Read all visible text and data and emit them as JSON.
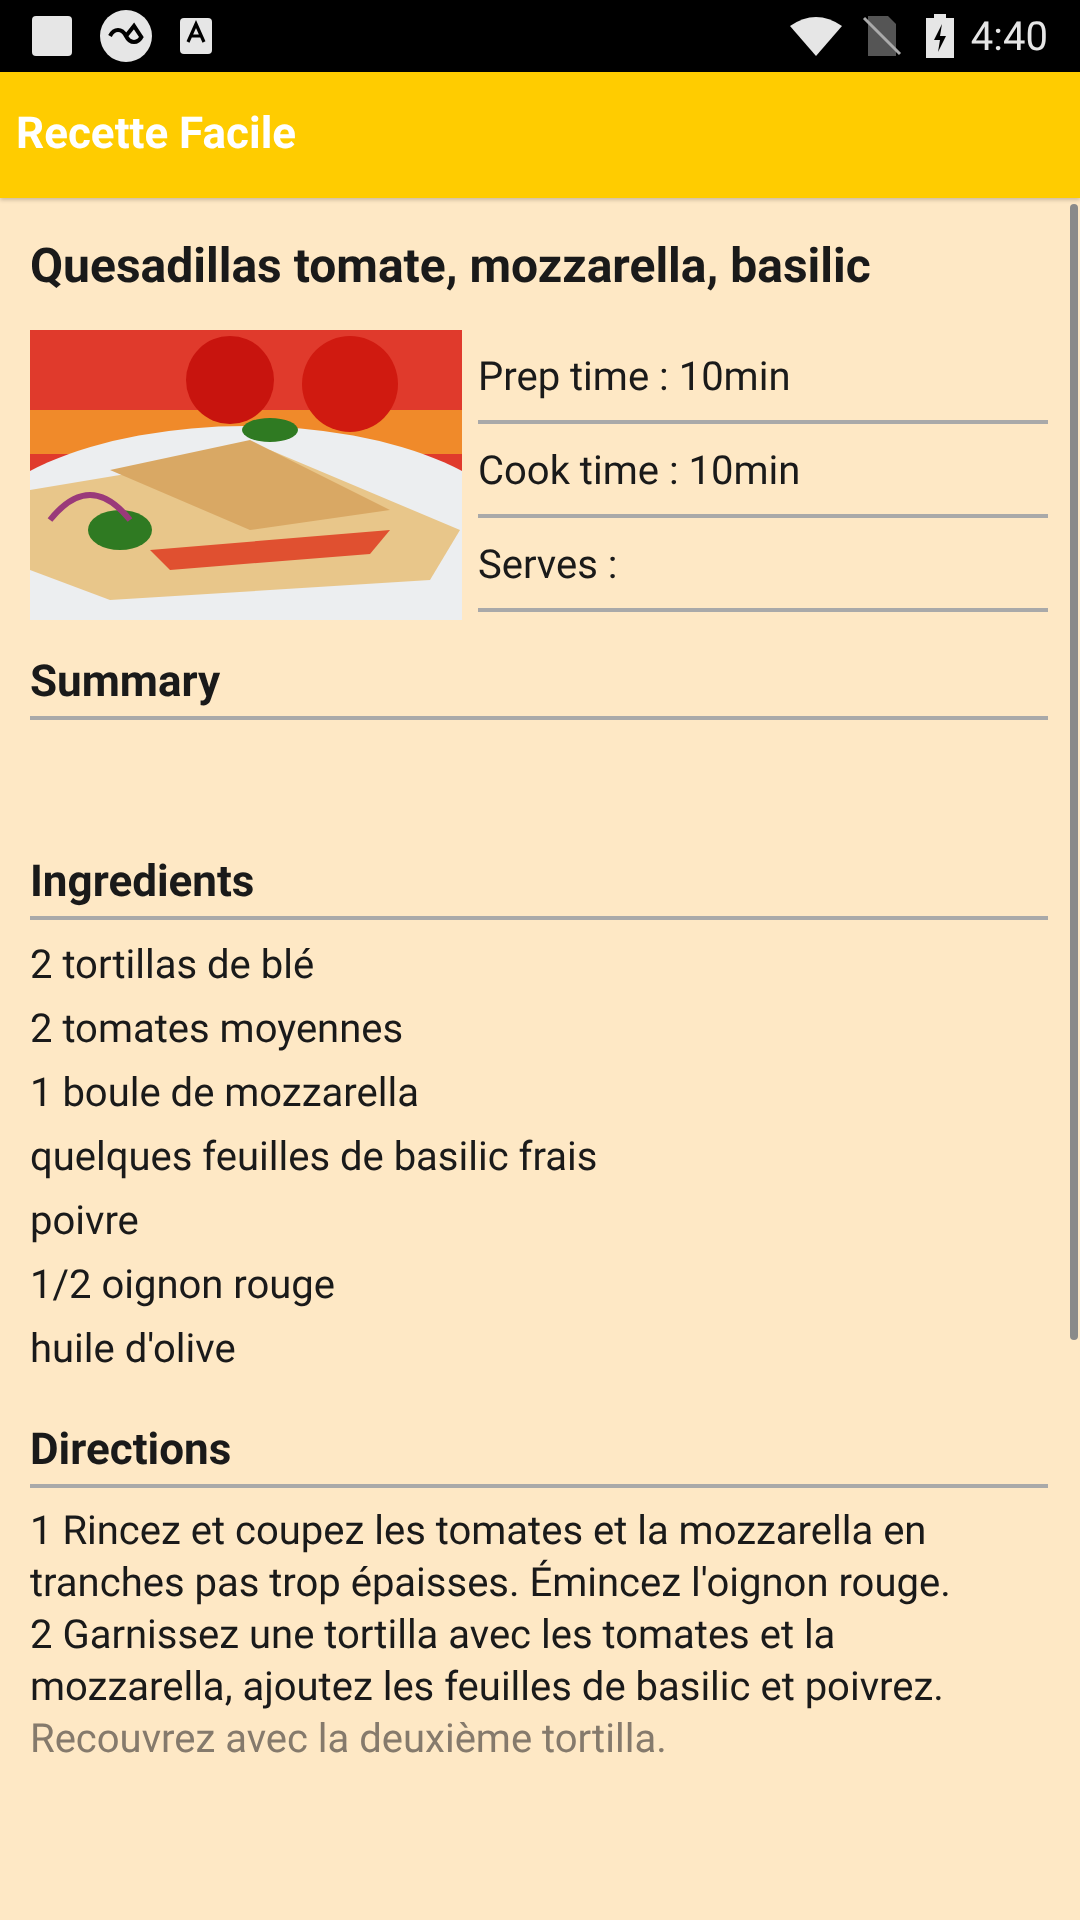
{
  "status_bar": {
    "time": "4:40"
  },
  "app_bar": {
    "title": "Recette Facile"
  },
  "recipe": {
    "title": "Quesadillas tomate, mozzarella, basilic",
    "info": [
      "Prep time : 10min",
      "Cook time : 10min",
      "Serves :"
    ]
  },
  "sections": [
    {
      "heading": "Summary"
    },
    {
      "heading": "Ingredients",
      "lines": [
        "2 tortillas de blé",
        "2 tomates moyennes",
        "1 boule de mozzarella",
        "quelques feuilles de basilic frais",
        "poivre",
        "1/2 oignon rouge",
        "huile d'olive"
      ]
    }
  ],
  "directions": {
    "heading": "Directions",
    "lines": [
      {
        "text": "1 Rincez et coupez les tomates et la mozzarella en tranches pas trop épaisses. Émincez l'oignon rouge.",
        "faded": false
      },
      {
        "text": "2 Garnissez une tortilla avec les tomates et la mozzarella, ajoutez les feuilles de basilic et poivrez.",
        "faded": false
      },
      {
        "text": "Recouvrez avec la deuxième tortilla.",
        "faded": true
      }
    ]
  }
}
